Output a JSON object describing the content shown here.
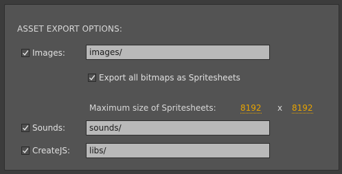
{
  "section_title": "ASSET EXPORT OPTIONS:",
  "images": {
    "checked": true,
    "label": "Images:",
    "path_value": "images/"
  },
  "spritesheets": {
    "checked": true,
    "label": "Export all bitmaps as Spritesheets",
    "max_size_label": "Maximum size of Spritesheets:",
    "width": "8192",
    "separator": "x",
    "height": "8192"
  },
  "sounds": {
    "checked": true,
    "label": "Sounds:",
    "path_value": "sounds/"
  },
  "createjs": {
    "checked": true,
    "label": "CreateJS:",
    "path_value": "libs/"
  },
  "colors": {
    "accent_link": "#e8a400",
    "panel_bg": "#535353",
    "field_bg": "#b9b9b9"
  }
}
